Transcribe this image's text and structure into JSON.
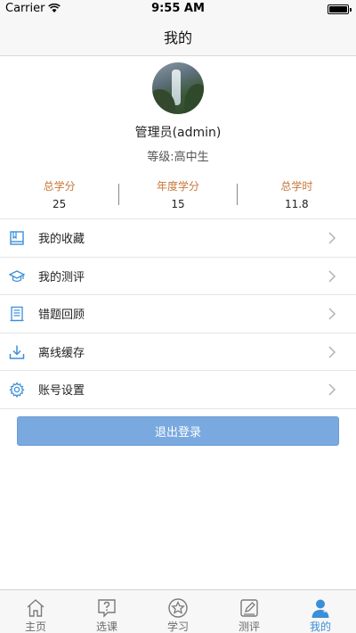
{
  "status_bar": {
    "carrier": "Carrier",
    "time": "9:55 AM"
  },
  "header": {
    "title": "我的"
  },
  "profile": {
    "username": "管理员(admin)",
    "level": "等级:高中生"
  },
  "stats": [
    {
      "label": "总学分",
      "value": "25"
    },
    {
      "label": "年度学分",
      "value": "15"
    },
    {
      "label": "总学时",
      "value": "11.8"
    }
  ],
  "menu": [
    {
      "label": "我的收藏",
      "icon": "bookmark-book-icon"
    },
    {
      "label": "我的测评",
      "icon": "graduation-cap-icon"
    },
    {
      "label": "错题回顾",
      "icon": "document-list-icon"
    },
    {
      "label": "离线缓存",
      "icon": "download-icon"
    },
    {
      "label": "账号设置",
      "icon": "gear-icon"
    }
  ],
  "logout_label": "退出登录",
  "tabs": [
    {
      "label": "主页",
      "icon": "home-icon"
    },
    {
      "label": "选课",
      "icon": "question-bubble-icon"
    },
    {
      "label": "学习",
      "icon": "star-circle-icon"
    },
    {
      "label": "测评",
      "icon": "edit-note-icon"
    },
    {
      "label": "我的",
      "icon": "person-icon",
      "active": true
    }
  ],
  "colors": {
    "accent": "#3b8ed8",
    "stat_label": "#c8763a",
    "logout_button": "#7aa9e0"
  }
}
